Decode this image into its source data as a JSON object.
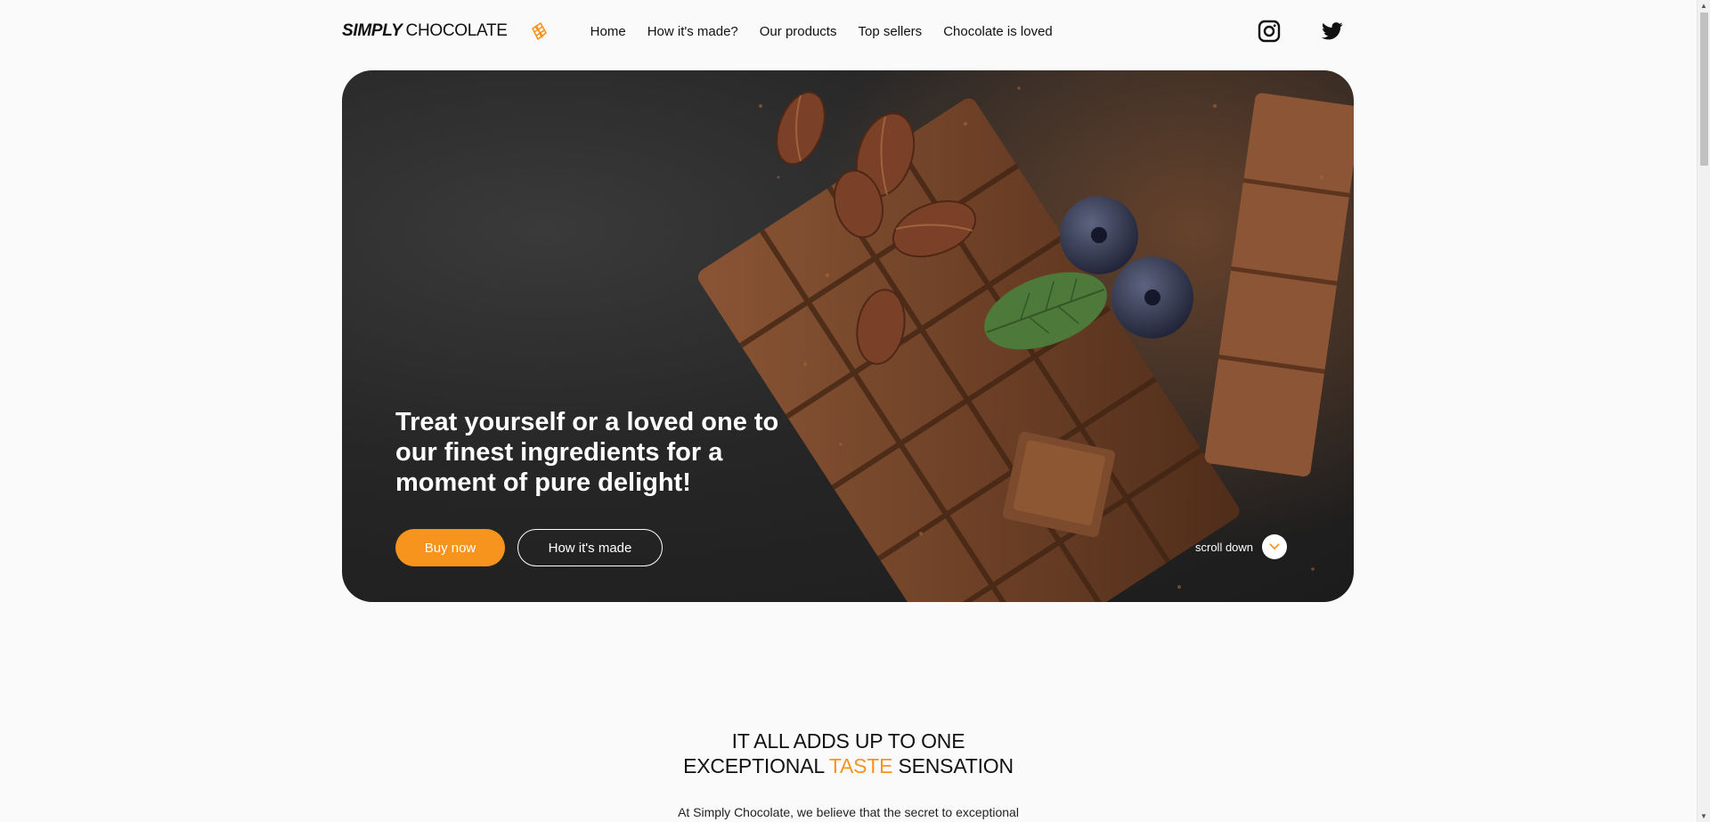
{
  "brand": {
    "name_bold": "SIMPLY",
    "name_rest": "CHOCOLATE",
    "accent_color": "#f7941d"
  },
  "nav": {
    "items": [
      {
        "label": "Home"
      },
      {
        "label": "How it's made?"
      },
      {
        "label": "Our products"
      },
      {
        "label": "Top sellers"
      },
      {
        "label": "Chocolate is loved"
      }
    ]
  },
  "socials": {
    "icons": [
      "instagram-icon",
      "twitter-icon"
    ]
  },
  "hero": {
    "title": "Treat yourself or a loved one to our finest ingredients for a moment of pure delight!",
    "buy_label": "Buy now",
    "how_label": "How it's made",
    "scroll_label": "scroll down"
  },
  "section": {
    "title_line1": "IT ALL ADDS UP TO ONE",
    "title_pre": "EXCEPTIONAL ",
    "title_accent": "TASTE",
    "title_post": " SENSATION",
    "text": "At Simply Chocolate, we believe that the secret to exceptional"
  }
}
